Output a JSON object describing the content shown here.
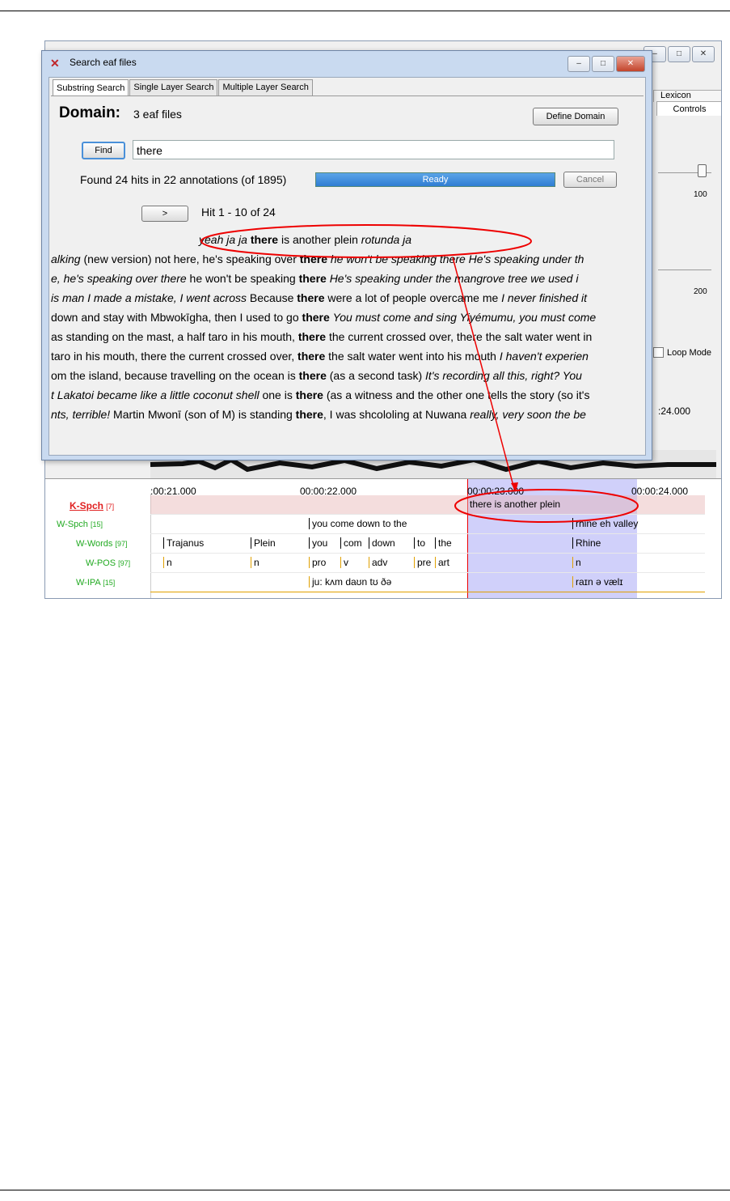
{
  "elan": {
    "window_buttons": [
      "–",
      "□",
      "✕"
    ],
    "tab_lexicon": "Lexicon",
    "tab_controls": "Controls",
    "slider1_value": "100",
    "slider2_value": "200",
    "loop_mode": "Loop Mode",
    "time_top": ":24.000",
    "ruler": [
      ":00:21.000",
      "00:00:22.000",
      "00:00:23.000",
      "00:00:24.000"
    ],
    "tiers": [
      {
        "name": "K-Spch",
        "count": "[7]",
        "color": "#e02020"
      },
      {
        "name": "W-Spch",
        "count": "[15]",
        "color": "#22aa22"
      },
      {
        "name": "W-Words",
        "count": "[97]",
        "color": "#22aa22"
      },
      {
        "name": "W-POS",
        "count": "[97]",
        "color": "#22aa22"
      },
      {
        "name": "W-IPA",
        "count": "[15]",
        "color": "#22aa22"
      }
    ],
    "annotations": {
      "kspch": [
        "there is another plein"
      ],
      "wspch": [
        "you come down to the",
        "rhine eh valley"
      ],
      "words": [
        "Trajanus",
        "Plein",
        "you",
        "com",
        "down",
        "to",
        "the",
        "Rhine"
      ],
      "pos": [
        "n",
        "n",
        "pro",
        "v",
        "adv",
        "pre",
        "art",
        "n"
      ],
      "ipa": [
        "ju: kʌm daʊn tʊ ðə",
        "raɪn ə vælɪ"
      ]
    }
  },
  "dialog": {
    "title": "Search eaf files",
    "tabs": [
      "Substring Search",
      "Single Layer Search",
      "Multiple Layer Search"
    ],
    "domain_label": "Domain:",
    "domain_value": "3 eaf files",
    "define_domain": "Define Domain",
    "find_button": "Find",
    "query": "there",
    "found_text": "Found 24 hits in 22 annotations (of 1895)",
    "progress_label": "Ready",
    "progress": 1.0,
    "cancel": "Cancel",
    "next_button": ">",
    "hit_text": "Hit 1 - 10 of 24",
    "results": [
      [
        {
          "t": "yeah  ja  ja",
          "s": "em"
        },
        {
          "t": " "
        },
        {
          "t": "there",
          "s": "kw"
        },
        {
          "t": " is another plein  "
        },
        {
          "t": "rotunda  ja",
          "s": "em"
        }
      ],
      [
        {
          "t": "alking",
          "s": "em"
        },
        {
          "t": "  (new version) not here, he's speaking over "
        },
        {
          "t": "there",
          "s": "kw"
        },
        {
          "t": "  "
        },
        {
          "t": "he won't be speaking there  He's speaking under th",
          "s": "em"
        }
      ],
      [
        {
          "t": "e, he's speaking over there",
          "s": "em"
        },
        {
          "t": "  he won't be speaking "
        },
        {
          "t": "there",
          "s": "kw"
        },
        {
          "t": "  "
        },
        {
          "t": "He's speaking under the mangrove tree    we used i",
          "s": "em"
        }
      ],
      [
        {
          "t": "is man  I made a mistake, I went across",
          "s": "em"
        },
        {
          "t": "  Because "
        },
        {
          "t": "there",
          "s": "kw"
        },
        {
          "t": " were a lot of people overcame me  "
        },
        {
          "t": "I never finished it",
          "s": "em"
        }
      ],
      [
        {
          "t": "down and stay with Mbwokīgha, then I used to go "
        },
        {
          "t": "there",
          "s": "kw"
        },
        {
          "t": "  "
        },
        {
          "t": "You must come and sing Yiyémumu, you must come",
          "s": "em"
        }
      ],
      [
        {
          "t": "as standing on the mast, a half taro in his mouth, "
        },
        {
          "t": "there",
          "s": "kw"
        },
        {
          "t": " the current crossed over, there the salt water went in"
        }
      ],
      [
        {
          "t": "taro in his mouth, there the current crossed over, "
        },
        {
          "t": "there",
          "s": "kw"
        },
        {
          "t": " the salt water went into his mouth  "
        },
        {
          "t": "I haven't experien",
          "s": "em"
        }
      ],
      [
        {
          "t": "om the island, because travelling on the ocean is "
        },
        {
          "t": "there",
          "s": "kw"
        },
        {
          "t": " (as a second task)  "
        },
        {
          "t": "It's recording all this, right?  You",
          "s": "em"
        }
      ],
      [
        {
          "t": "t  Lakatoi became like a little coconut shell",
          "s": "em"
        },
        {
          "t": "  one is "
        },
        {
          "t": "there",
          "s": "kw"
        },
        {
          "t": " (as a witness and the other one tells the story (so it's"
        }
      ],
      [
        {
          "t": "nts, terrible!",
          "s": "em"
        },
        {
          "t": " Martin Mwonī (son of M) is standing "
        },
        {
          "t": "there",
          "s": "kw"
        },
        {
          "t": ", I was shcololing at Nuwana  "
        },
        {
          "t": "really, very soon the be",
          "s": "em"
        }
      ]
    ]
  },
  "colors": {
    "highlight": "#e00000",
    "selection": "#7878f0",
    "progress": "#2f7dd3"
  }
}
